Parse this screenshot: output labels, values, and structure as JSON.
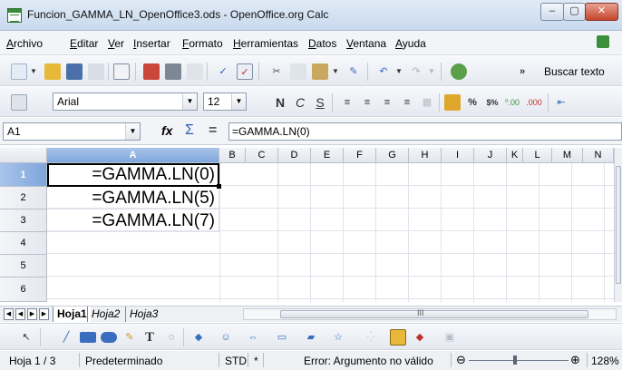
{
  "window": {
    "title": "Funcion_GAMMA_LN_OpenOffice3.ods - OpenOffice.org Calc",
    "buttons": {
      "minimize": "–",
      "maximize": "▢",
      "close": "✕"
    }
  },
  "menu": [
    "Archivo",
    "Editar",
    "Ver",
    "Insertar",
    "Formato",
    "Herramientas",
    "Datos",
    "Ventana",
    "Ayuda"
  ],
  "toolbar": {
    "more": "»",
    "find_label": "Buscar texto",
    "font_name": "Arial",
    "font_size": "12",
    "bold": "N",
    "italic": "C",
    "underline": "S",
    "percent": "%",
    "currency": "$%",
    "decimal_add": "⁰.00",
    "decimal_remove": ".000"
  },
  "formula_bar": {
    "name_box": "A1",
    "function_wizard": "fx",
    "sum": "Σ",
    "equals": "=",
    "content": "=GAMMA.LN(0)"
  },
  "grid": {
    "columns": [
      "A",
      "B",
      "C",
      "D",
      "E",
      "F",
      "G",
      "H",
      "I",
      "J",
      "K",
      "L",
      "M",
      "N"
    ],
    "rows": [
      "1",
      "2",
      "3",
      "4",
      "5",
      "6"
    ],
    "cells": [
      "=GAMMA.LN(0)",
      "=GAMMA.LN(5)",
      "=GAMMA.LN(7)"
    ],
    "selected_cell": "A1"
  },
  "sheets": {
    "tabs": [
      "Hoja1",
      "Hoja2",
      "Hoja3"
    ],
    "active": "Hoja1",
    "scroll_mark": "III"
  },
  "status": {
    "sheet_position": "Hoja 1 / 3",
    "page_style": "Predeterminado",
    "mode": "STD",
    "modified": "*",
    "message": "Error: Argumento no válido",
    "zoom_minus": "⊖",
    "zoom_plus": "⊕",
    "zoom": "128%"
  },
  "colors": {
    "selection_header": "#7fa6db",
    "titlebar": "#c9daee",
    "close_button": "#c4452e"
  }
}
